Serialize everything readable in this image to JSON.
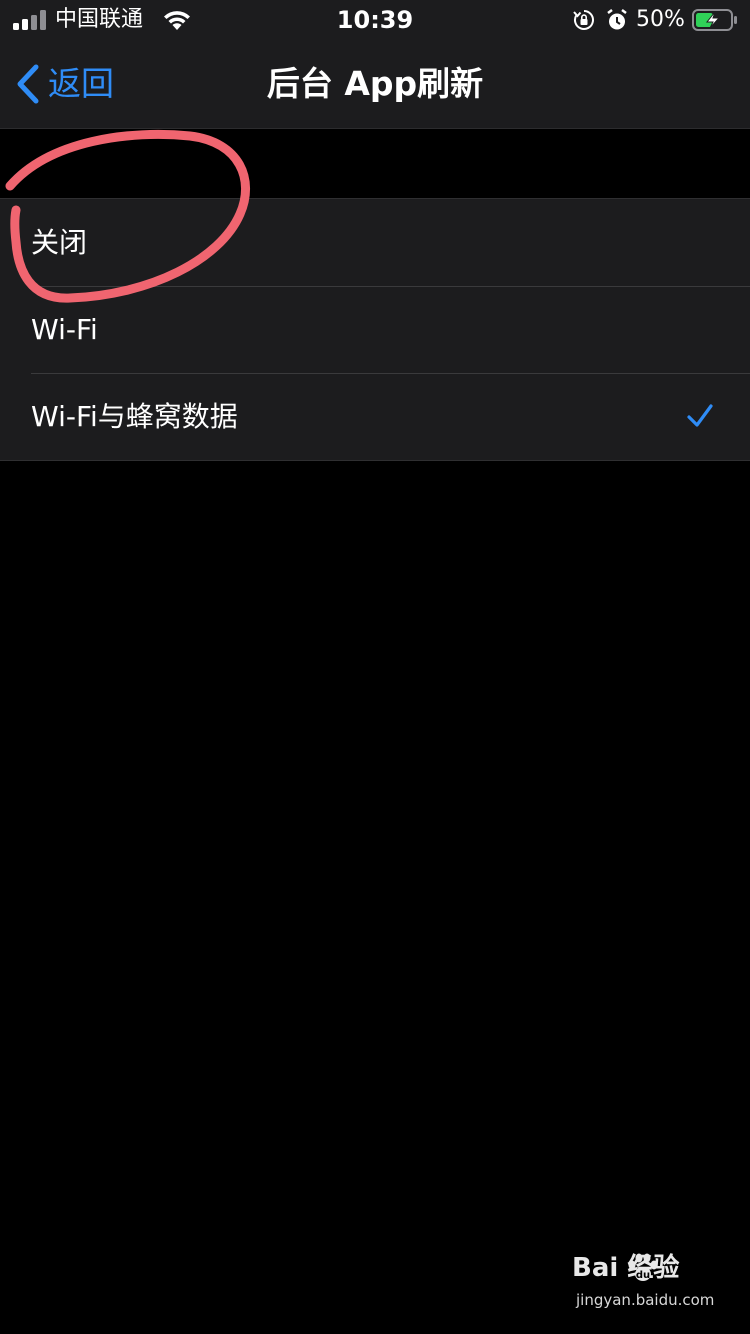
{
  "status_bar": {
    "carrier": "中国联通",
    "time": "10:39",
    "battery_percent": "50%",
    "signal_icon": "signal-bars-icon",
    "wifi_icon": "wifi-icon",
    "rotation_lock_icon": "rotation-lock-icon",
    "alarm_icon": "alarm-icon",
    "battery_icon": "battery-charging-icon"
  },
  "nav": {
    "back_label": "返回",
    "title": "后台 App刷新"
  },
  "options": [
    {
      "label": "关闭",
      "selected": false
    },
    {
      "label": "Wi-Fi",
      "selected": false
    },
    {
      "label": "Wi-Fi与蜂窝数据",
      "selected": true
    }
  ],
  "colors": {
    "accent": "#2f8cf6",
    "background": "#000000",
    "surface": "#1c1c1e",
    "annotation": "#f06570",
    "battery_fill": "#30d158"
  },
  "watermark": {
    "logo": "Bai  经验",
    "url": "jingyan.baidu.com"
  }
}
